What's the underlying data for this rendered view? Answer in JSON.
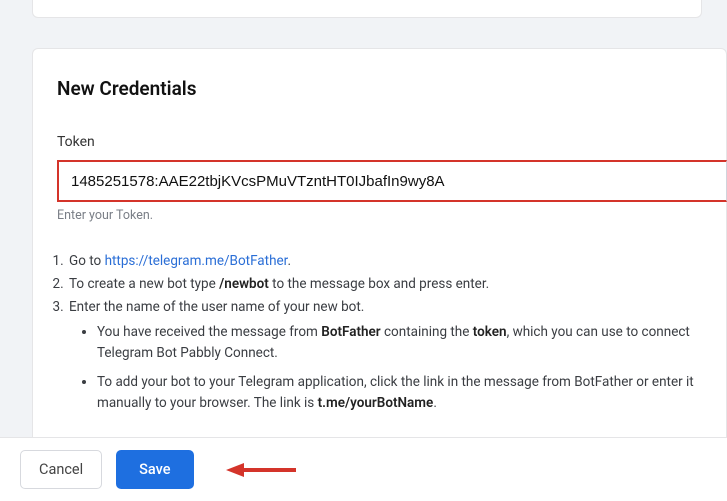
{
  "card": {
    "title": "New Credentials",
    "tokenLabel": "Token",
    "tokenValue": "1485251578:AAE22tbjKVcsPMuVTzntHT0IJbafIn9wy8A",
    "tokenHelper": "Enter your Token."
  },
  "instructions": {
    "step1_prefix": "Go to ",
    "step1_link": "https://telegram.me/BotFather",
    "step1_suffix": ".",
    "step2_prefix": "To create a new bot type ",
    "step2_cmd": "/newbot",
    "step2_suffix": " to the message box and press enter.",
    "step3": "Enter the name of the user name of your new bot.",
    "bullet1_a": "You have received the message from ",
    "bullet1_b": "BotFather",
    "bullet1_c": " containing the ",
    "bullet1_d": "token",
    "bullet1_e": ", which you can use to connect Telegram Bot Pabbly Connect.",
    "bullet2_a": "To add your bot to your Telegram application, click the link in the message from BotFather or enter it manually to your browser. The link is ",
    "bullet2_b": "t.me/yourBotName",
    "bullet2_c": "."
  },
  "footer": {
    "cancel": "Cancel",
    "save": "Save"
  }
}
